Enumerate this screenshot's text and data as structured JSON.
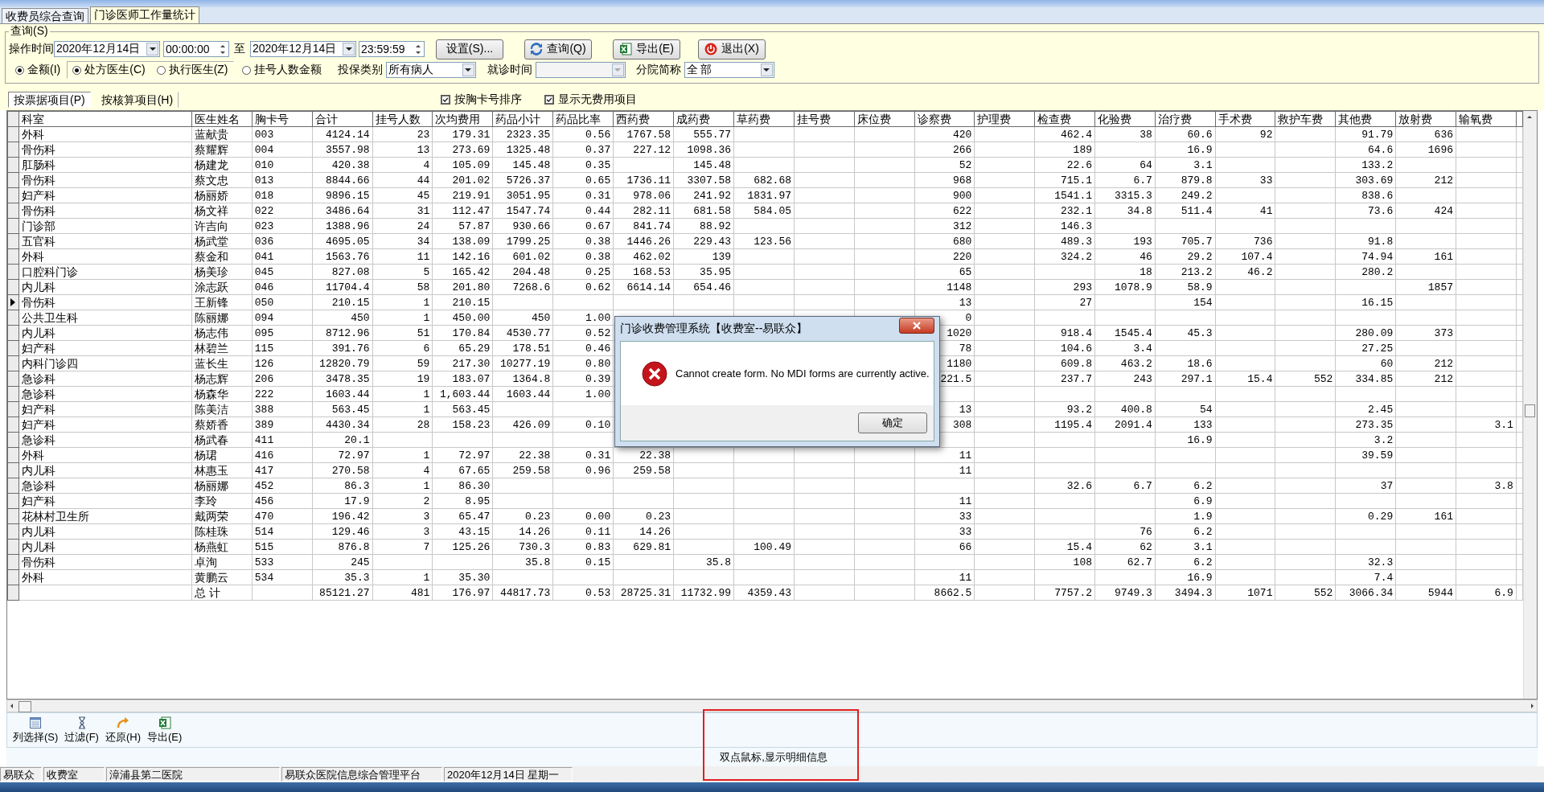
{
  "window_tabs": [
    {
      "label": "收费员综合查询",
      "selected": false
    },
    {
      "label": "门诊医师工作量统计",
      "selected": true
    }
  ],
  "query": {
    "title": "查询(S)",
    "time_label": "操作时间",
    "start_date": "2020年12月14日",
    "start_time": "00:00:00",
    "to_label": "至",
    "end_date": "2020年12月14日",
    "end_time": "23:59:59",
    "buttons": [
      "设置(S)...",
      "查询(Q)",
      "导出(E)",
      "退出(X)"
    ],
    "mode_radios": [
      {
        "label": "金额(I)",
        "selected": true
      },
      {
        "label": "挂号人数金额",
        "selected": false
      }
    ],
    "doctor_radios": [
      {
        "label": "处方医生(C)",
        "selected": true
      },
      {
        "label": "执行医生(Z)",
        "selected": false
      }
    ],
    "insurance": {
      "label": "投保类别",
      "value": "所有病人"
    },
    "visit_time": {
      "label": "就诊时间",
      "disabled": true
    },
    "branch": {
      "label": "分院简称",
      "value": "全 部"
    }
  },
  "view_tabs": [
    {
      "label": "按票据项目(P)",
      "selected": true
    },
    {
      "label": "按核算项目(H)",
      "selected": false
    }
  ],
  "options": [
    {
      "label": "按胸卡号排序",
      "checked": true
    },
    {
      "label": "显示无费用项目",
      "checked": true
    }
  ],
  "table": {
    "columns": [
      "科室",
      "医生姓名",
      "胸卡号",
      "合计",
      "挂号人数",
      "次均费用",
      "药品小计",
      "药品比率",
      "西药费",
      "成药费",
      "草药费",
      "挂号费",
      "床位费",
      "诊察费",
      "护理费",
      "检查费",
      "化验费",
      "治疗费",
      "手术费",
      "救护车费",
      "其他费",
      "放射费",
      "输氧费"
    ],
    "rows": [
      {
        "current": false,
        "cells": [
          "外科",
          "蓝献贵",
          "003",
          "4124.14",
          "23",
          "179.31",
          "2323.35",
          "0.56",
          "1767.58",
          "555.77",
          null,
          null,
          null,
          "420",
          null,
          "462.4",
          "38",
          "60.6",
          "92",
          null,
          "91.79",
          "636",
          null
        ]
      },
      {
        "current": false,
        "cells": [
          "骨伤科",
          "蔡耀辉",
          "004",
          "3557.98",
          "13",
          "273.69",
          "1325.48",
          "0.37",
          "227.12",
          "1098.36",
          null,
          null,
          null,
          "266",
          null,
          "189",
          null,
          "16.9",
          null,
          null,
          "64.6",
          "1696",
          null
        ]
      },
      {
        "current": false,
        "cells": [
          "肛肠科",
          "杨建龙",
          "010",
          "420.38",
          "4",
          "105.09",
          "145.48",
          "0.35",
          null,
          "145.48",
          null,
          null,
          null,
          "52",
          null,
          "22.6",
          "64",
          "3.1",
          null,
          null,
          "133.2",
          null,
          null
        ]
      },
      {
        "current": false,
        "cells": [
          "骨伤科",
          "蔡文忠",
          "013",
          "8844.66",
          "44",
          "201.02",
          "5726.37",
          "0.65",
          "1736.11",
          "3307.58",
          "682.68",
          null,
          null,
          "968",
          null,
          "715.1",
          "6.7",
          "879.8",
          "33",
          null,
          "303.69",
          "212",
          null
        ]
      },
      {
        "current": false,
        "cells": [
          "妇产科",
          "杨丽娇",
          "018",
          "9896.15",
          "45",
          "219.91",
          "3051.95",
          "0.31",
          "978.06",
          "241.92",
          "1831.97",
          null,
          null,
          "900",
          null,
          "1541.1",
          "3315.3",
          "249.2",
          null,
          null,
          "838.6",
          null,
          null
        ]
      },
      {
        "current": false,
        "cells": [
          "骨伤科",
          "杨文祥",
          "022",
          "3486.64",
          "31",
          "112.47",
          "1547.74",
          "0.44",
          "282.11",
          "681.58",
          "584.05",
          null,
          null,
          "622",
          null,
          "232.1",
          "34.8",
          "511.4",
          "41",
          null,
          "73.6",
          "424",
          null
        ]
      },
      {
        "current": false,
        "cells": [
          "门诊部",
          "许吉向",
          "023",
          "1388.96",
          "24",
          "57.87",
          "930.66",
          "0.67",
          "841.74",
          "88.92",
          null,
          null,
          null,
          "312",
          null,
          "146.3",
          null,
          null,
          null,
          null,
          null,
          null,
          null
        ]
      },
      {
        "current": false,
        "cells": [
          "五官科",
          "杨武堂",
          "036",
          "4695.05",
          "34",
          "138.09",
          "1799.25",
          "0.38",
          "1446.26",
          "229.43",
          "123.56",
          null,
          null,
          "680",
          null,
          "489.3",
          "193",
          "705.7",
          "736",
          null,
          "91.8",
          null,
          null
        ]
      },
      {
        "current": false,
        "cells": [
          "外科",
          "蔡金和",
          "041",
          "1563.76",
          "11",
          "142.16",
          "601.02",
          "0.38",
          "462.02",
          "139",
          null,
          null,
          null,
          "220",
          null,
          "324.2",
          "46",
          "29.2",
          "107.4",
          null,
          "74.94",
          "161",
          null
        ]
      },
      {
        "current": false,
        "cells": [
          "口腔科门诊",
          "杨美珍",
          "045",
          "827.08",
          "5",
          "165.42",
          "204.48",
          "0.25",
          "168.53",
          "35.95",
          null,
          null,
          null,
          "65",
          null,
          null,
          "18",
          "213.2",
          "46.2",
          null,
          "280.2",
          null,
          null
        ]
      },
      {
        "current": false,
        "cells": [
          "内儿科",
          "涂志跃",
          "046",
          "11704.4",
          "58",
          "201.80",
          "7268.6",
          "0.62",
          "6614.14",
          "654.46",
          null,
          null,
          null,
          "1148",
          null,
          "293",
          "1078.9",
          "58.9",
          null,
          null,
          null,
          "1857",
          null
        ]
      },
      {
        "current": true,
        "cells": [
          "骨伤科",
          "王新锋",
          "050",
          "210.15",
          "1",
          "210.15",
          null,
          null,
          null,
          null,
          null,
          null,
          null,
          "13",
          null,
          "27",
          null,
          "154",
          null,
          null,
          "16.15",
          null,
          null
        ]
      },
      {
        "current": false,
        "cells": [
          "公共卫生科",
          "陈丽娜",
          "094",
          "450",
          "1",
          "450.00",
          "450",
          "1.00",
          null,
          null,
          null,
          null,
          null,
          "0",
          null,
          null,
          null,
          null,
          null,
          null,
          null,
          null,
          null
        ]
      },
      {
        "current": false,
        "cells": [
          "内儿科",
          "杨志伟",
          "095",
          "8712.96",
          "51",
          "170.84",
          "4530.77",
          "0.52",
          null,
          null,
          null,
          null,
          null,
          "1020",
          null,
          "918.4",
          "1545.4",
          "45.3",
          null,
          null,
          "280.09",
          "373",
          null
        ]
      },
      {
        "current": false,
        "cells": [
          "妇产科",
          "林碧兰",
          "115",
          "391.76",
          "6",
          "65.29",
          "178.51",
          "0.46",
          null,
          null,
          null,
          null,
          null,
          "78",
          null,
          "104.6",
          "3.4",
          null,
          null,
          null,
          "27.25",
          null,
          null
        ]
      },
      {
        "current": false,
        "cells": [
          "内科门诊四",
          "蓝长生",
          "126",
          "12820.79",
          "59",
          "217.30",
          "10277.19",
          "0.80",
          null,
          null,
          null,
          null,
          null,
          "1180",
          null,
          "609.8",
          "463.2",
          "18.6",
          null,
          null,
          "60",
          "212",
          null
        ]
      },
      {
        "current": false,
        "cells": [
          "急诊科",
          "杨志辉",
          "206",
          "3478.35",
          "19",
          "183.07",
          "1364.8",
          "0.39",
          null,
          null,
          null,
          null,
          null,
          "221.5",
          null,
          "237.7",
          "243",
          "297.1",
          "15.4",
          "552",
          "334.85",
          "212",
          null
        ]
      },
      {
        "current": false,
        "cells": [
          "急诊科",
          "杨森华",
          "222",
          "1603.44",
          "1",
          "1,603.44",
          "1603.44",
          "1.00",
          null,
          null,
          null,
          null,
          null,
          null,
          null,
          null,
          null,
          null,
          null,
          null,
          null,
          null,
          null
        ]
      },
      {
        "current": false,
        "cells": [
          "妇产科",
          "陈美洁",
          "388",
          "563.45",
          "1",
          "563.45",
          null,
          null,
          null,
          null,
          null,
          null,
          null,
          "13",
          null,
          "93.2",
          "400.8",
          "54",
          null,
          null,
          "2.45",
          null,
          null
        ]
      },
      {
        "current": false,
        "cells": [
          "妇产科",
          "蔡娇香",
          "389",
          "4430.34",
          "28",
          "158.23",
          "426.09",
          "0.10",
          null,
          null,
          null,
          null,
          null,
          "308",
          null,
          "1195.4",
          "2091.4",
          "133",
          null,
          null,
          "273.35",
          null,
          "3.1"
        ]
      },
      {
        "current": false,
        "cells": [
          "急诊科",
          "杨武春",
          "411",
          "20.1",
          null,
          null,
          null,
          null,
          null,
          null,
          null,
          null,
          null,
          null,
          null,
          null,
          null,
          "16.9",
          null,
          null,
          "3.2",
          null,
          null
        ]
      },
      {
        "current": false,
        "cells": [
          "外科",
          "杨珺",
          "416",
          "72.97",
          "1",
          "72.97",
          "22.38",
          "0.31",
          "22.38",
          null,
          null,
          null,
          null,
          "11",
          null,
          null,
          null,
          null,
          null,
          null,
          "39.59",
          null,
          null
        ]
      },
      {
        "current": false,
        "cells": [
          "内儿科",
          "林惠玉",
          "417",
          "270.58",
          "4",
          "67.65",
          "259.58",
          "0.96",
          "259.58",
          null,
          null,
          null,
          null,
          "11",
          null,
          null,
          null,
          null,
          null,
          null,
          null,
          null,
          null
        ]
      },
      {
        "current": false,
        "cells": [
          "急诊科",
          "杨丽娜",
          "452",
          "86.3",
          "1",
          "86.30",
          null,
          null,
          null,
          null,
          null,
          null,
          null,
          null,
          null,
          "32.6",
          "6.7",
          "6.2",
          null,
          null,
          "37",
          null,
          "3.8"
        ]
      },
      {
        "current": false,
        "cells": [
          "妇产科",
          "李玲",
          "456",
          "17.9",
          "2",
          "8.95",
          null,
          null,
          null,
          null,
          null,
          null,
          null,
          "11",
          null,
          null,
          null,
          "6.9",
          null,
          null,
          null,
          null,
          null
        ]
      },
      {
        "current": false,
        "cells": [
          "花林村卫生所",
          "戴两荣",
          "470",
          "196.42",
          "3",
          "65.47",
          "0.23",
          "0.00",
          "0.23",
          null,
          null,
          null,
          null,
          "33",
          null,
          null,
          null,
          "1.9",
          null,
          null,
          "0.29",
          "161",
          null
        ]
      },
      {
        "current": false,
        "cells": [
          "内儿科",
          "陈桂珠",
          "514",
          "129.46",
          "3",
          "43.15",
          "14.26",
          "0.11",
          "14.26",
          null,
          null,
          null,
          null,
          "33",
          null,
          null,
          "76",
          "6.2",
          null,
          null,
          null,
          null,
          null
        ]
      },
      {
        "current": false,
        "cells": [
          "内儿科",
          "杨燕虹",
          "515",
          "876.8",
          "7",
          "125.26",
          "730.3",
          "0.83",
          "629.81",
          null,
          "100.49",
          null,
          null,
          "66",
          null,
          "15.4",
          "62",
          "3.1",
          null,
          null,
          null,
          null,
          null
        ]
      },
      {
        "current": false,
        "cells": [
          "骨伤科",
          "卓洵",
          "533",
          "245",
          null,
          null,
          "35.8",
          "0.15",
          null,
          "35.8",
          null,
          null,
          null,
          null,
          null,
          "108",
          "62.7",
          "6.2",
          null,
          null,
          "32.3",
          null,
          null
        ]
      },
      {
        "current": false,
        "cells": [
          "外科",
          "黄鹏云",
          "534",
          "35.3",
          "1",
          "35.30",
          null,
          null,
          null,
          null,
          null,
          null,
          null,
          "11",
          null,
          null,
          null,
          "16.9",
          null,
          null,
          "7.4",
          null,
          null
        ]
      }
    ],
    "total": {
      "cells": [
        null,
        "总 计",
        null,
        "85121.27",
        "481",
        "176.97",
        "44817.73",
        "0.53",
        "28725.31",
        "11732.99",
        "4359.43",
        null,
        null,
        "8662.5",
        null,
        "7757.2",
        "9749.3",
        "3494.3",
        "1071",
        "552",
        "3066.34",
        "5944",
        "6.9"
      ]
    }
  },
  "toolbar": [
    "列选择(S)",
    "过滤(F)",
    "还原(H)",
    "导出(E)"
  ],
  "hint": "双点鼠标,显示明细信息",
  "status_bar": [
    "易联众",
    "收费室",
    "漳浦县第二医院",
    "易联众医院信息综合管理平台",
    "2020年12月14日 星期一"
  ],
  "dialog": {
    "title": "门诊收费管理系统【收费室--易联众】",
    "message": "Cannot create form. No MDI forms are currently active.",
    "button": "确定"
  }
}
